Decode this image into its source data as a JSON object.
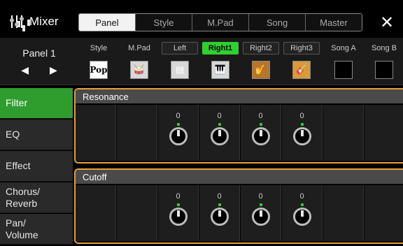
{
  "app": {
    "title": "Mixer",
    "icon": "mixer-icon"
  },
  "tabs": [
    {
      "label": "Panel",
      "active": true
    },
    {
      "label": "Style",
      "active": false
    },
    {
      "label": "M.Pad",
      "active": false
    },
    {
      "label": "Song",
      "active": false
    },
    {
      "label": "Master",
      "active": false
    }
  ],
  "close_icon": "✕",
  "panel_selector": {
    "name": "Panel 1",
    "prev": "◀",
    "next": "▶"
  },
  "parts": [
    {
      "label": "Style",
      "icon": "pop-style-icon",
      "glyph": "Pop",
      "active": false
    },
    {
      "label": "M.Pad",
      "icon": "drum-kit-icon",
      "glyph": "🥁",
      "active": false
    },
    {
      "label": "Left",
      "icon": "keyboard-icon",
      "glyph": "▤",
      "active": false
    },
    {
      "label": "Right1",
      "icon": "grand-piano-icon",
      "glyph": "🎹",
      "active": true
    },
    {
      "label": "Right2",
      "icon": "saxophone-icon",
      "glyph": "🎷",
      "active": false
    },
    {
      "label": "Right3",
      "icon": "acoustic-guitar-icon",
      "glyph": "🎸",
      "active": false
    },
    {
      "label": "Song A",
      "icon": "empty-slot-icon",
      "glyph": "",
      "active": false
    },
    {
      "label": "Song B",
      "icon": "empty-slot-icon",
      "glyph": "",
      "active": false
    }
  ],
  "sidebar": [
    {
      "label": "Filter",
      "active": true
    },
    {
      "label": "EQ",
      "active": false
    },
    {
      "label": "Effect",
      "active": false
    },
    {
      "label": "Chorus/\nReverb",
      "active": false
    },
    {
      "label": "Pan/\nVolume",
      "active": false
    }
  ],
  "groups": [
    {
      "title": "Resonance",
      "values": [
        "",
        "",
        "0",
        "0",
        "0",
        "0",
        "",
        ""
      ]
    },
    {
      "title": "Cutoff",
      "values": [
        "",
        "",
        "0",
        "0",
        "0",
        "0",
        "",
        ""
      ]
    }
  ],
  "colors": {
    "accent_green": "#2ed12e",
    "group_border": "#e5a03a",
    "active_sidebar": "#2e9d2e"
  }
}
